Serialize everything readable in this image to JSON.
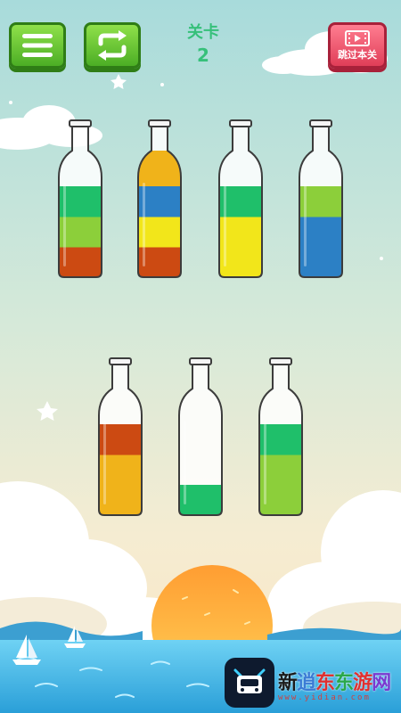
{
  "header": {
    "menu_icon": "menu-icon",
    "restart_icon": "restart-icon",
    "level_title": "关卡",
    "level_number": "2",
    "skip_label": "跳过本关",
    "skip_icon": "video-icon"
  },
  "bottles": [
    {
      "layers": [
        "#1fbf6a",
        "#8ccf3a",
        "#cc4a12"
      ]
    },
    {
      "layers": [
        "#f0b31a",
        "#2c80c5",
        "#f2e61a",
        "#cc4a12"
      ]
    },
    {
      "layers": [
        "#1fbf6a",
        "#f2e61a",
        "#f2e61a"
      ]
    },
    {
      "layers": [
        "#8ccf3a",
        "#2c80c5",
        "#2c80c5"
      ]
    },
    {
      "layers": [
        "#cc4a12",
        "#f0b31a",
        "#f0b31a"
      ]
    },
    {
      "layers": [
        "#1fbf6a"
      ]
    },
    {
      "layers": [
        "#1fbf6a",
        "#8ccf3a",
        "#8ccf3a"
      ]
    }
  ],
  "watermark": {
    "text": "新逍东东游网",
    "url": "www.yidian.com",
    "colors": [
      "#1a1a1a",
      "#3a7bd5",
      "#e03030",
      "#2aa84a",
      "#e03030",
      "#7a3ad0"
    ]
  },
  "colors": {
    "sky_top": "#a8dada",
    "sky_bottom": "#f5ead0",
    "sun": "#ffae3a",
    "sea": "#3fb7e8"
  }
}
